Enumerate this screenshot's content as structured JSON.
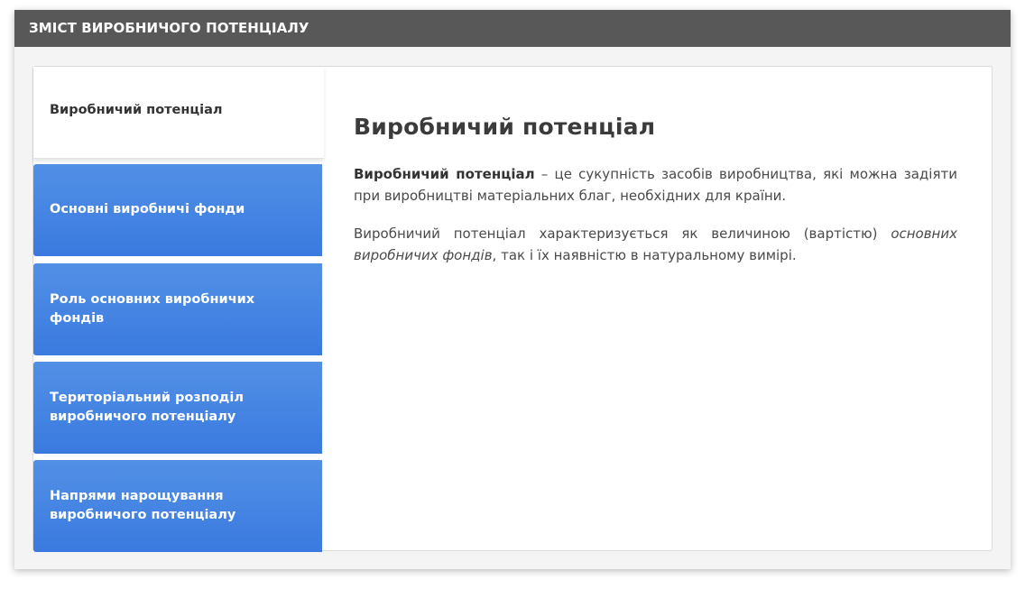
{
  "header": {
    "title": "ЗМІСТ ВИРОБНИЧОГО ПОТЕНЦІАЛУ"
  },
  "tabs": [
    {
      "label": "Виробничий потенціал",
      "active": true
    },
    {
      "label": "Основні виробничі фонди",
      "active": false
    },
    {
      "label": "Роль основних виробничих фондів",
      "active": false
    },
    {
      "label": "Територіальний розподіл виробничого потенціалу",
      "active": false
    },
    {
      "label": "Напрями нарощування виробничого потенціалу",
      "active": false
    }
  ],
  "content": {
    "title": "Виробничий потенціал",
    "p1_term": "Виробничий потенціал",
    "p1_text": " – це сукупність засобів виробництва, які можна задіяти при виробництві матеріальних благ, необхідних для країни.",
    "p2_text_a": "Виробничий потенціал характеризується як величиною (вартістю) ",
    "p2_italic": "основних виробничих фондів",
    "p2_text_b": ", так і їх наявністю в натуральному вимірі."
  },
  "colors": {
    "header_bg": "#585858",
    "tab_blue_top": "#5290e6",
    "tab_blue_bottom": "#3a7adf",
    "active_tab_bg": "#ffffff"
  }
}
